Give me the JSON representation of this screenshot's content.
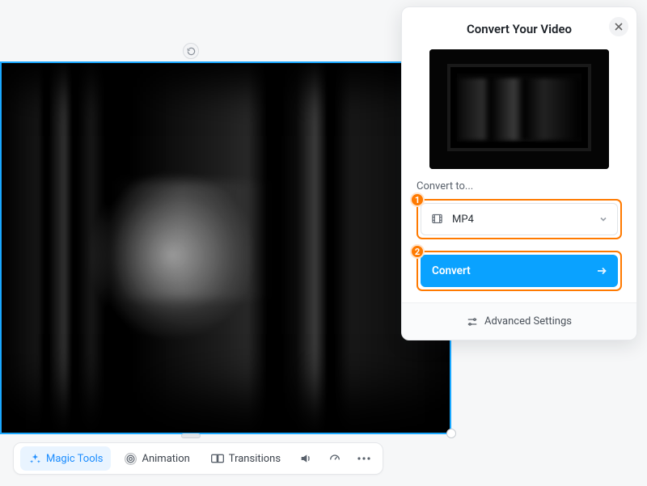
{
  "toolbar": {
    "magic_tools": "Magic Tools",
    "animation": "Animation",
    "transitions": "Transitions"
  },
  "panel": {
    "title": "Convert Your Video",
    "convert_to_label": "Convert to...",
    "format_selected": "MP4",
    "convert_button": "Convert",
    "advanced_settings": "Advanced Settings"
  },
  "steps": {
    "one": "1",
    "two": "2"
  }
}
